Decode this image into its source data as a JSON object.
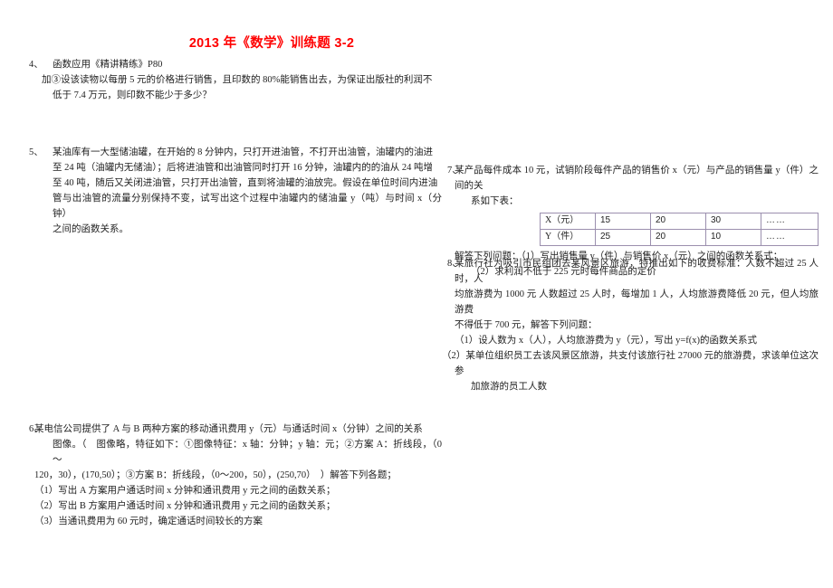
{
  "document": {
    "title": "2013 年《数学》训练题 3-2",
    "title_color": "#ff0000"
  },
  "problems": [
    {
      "id": "prob4",
      "number": "4、",
      "lines": [
        "函数应用《精讲精练》P80",
        "加③设该读物以每册 5 元的价格进行销售，且印数的 80%能销售出去，为保证出版社的利润不",
        "低于 7.4 万元，则印数不能少于多少？"
      ]
    },
    {
      "id": "prob5",
      "number": "5、",
      "lines": [
        "某油库有一大型储油罐，在开始的 8 分钟内，只打开进油管，不打开出油管，油罐内的油进",
        "至 24 吨（油罐内无储油）；后将进油管和出油管同时打开 16 分钟，油罐内的的油从 24 吨增",
        "至 40 吨，随后又关闭进油管，只打开出油管，直到将油罐的油放完。假设在单位时间内进油",
        "管与出油管的流量分别保持不变，试写出这个过程中油罐内的储油量 y（吨）与时间 x（分钟）",
        "之间的函数关系。"
      ]
    },
    {
      "id": "prob6",
      "number": "6、",
      "lines": [
        "某电信公司提供了 A 与 B 两种方案的移动通讯费用 y（元）与通话时间 x（分钟）之间的关系",
        "图像。（　图像略，特征如下：①图像特征：x 轴：分钟；y 轴：元；②方案 A：折线段，（0～",
        "120，30），(170,50）；③方案 B：折线段，（0～200，50），(250,70）　）解答下列各题；",
        "（1）写出 A 方案用户通话时间 x 分钟和通讯费用 y 元之间的函数关系；",
        "（2）写出 B 方案用户通话时间 x 分钟和通讯费用 y 元之间的函数关系；",
        "（3）当通讯费用为 60 元时，确定通话时间较长的方案"
      ]
    },
    {
      "id": "prob7",
      "number": "7、",
      "lines_before_table": [
        "某产品每件成本 10 元，试销阶段每件产品的销售价 x（元）与产品的销售量 y（件）之间的关",
        "系如下表："
      ],
      "lines_after_table": [
        "解答下列问题：（1）写出销售量 y（件）与销售价 x（元）之间的函数关系式；",
        "（2）求利润不低于 225 元时每件商品的定价"
      ],
      "table": {
        "rows": [
          {
            "header": "X（元）",
            "values": [
              "15",
              "20",
              "30",
              "……"
            ]
          },
          {
            "header": "Y（件）",
            "values": [
              "25",
              "20",
              "10",
              "……"
            ]
          }
        ]
      }
    },
    {
      "id": "prob8",
      "number": "8、",
      "lines": [
        "某旅行社为吸引市民组团去某风景区旅游，特推出如下的收费标准：人数不超过 25 人时，人",
        "均旅游费为 1000 元 人数超过 25 人时，每增加 1 人，人均旅游费降低 20 元，但人均旅游费",
        "不得低于 700 元，解答下列问题：",
        "（1）设人数为 x（人），人均旅游费为 y（元），写出 y=f(x)的函数关系式",
        "（2）某单位组织员工去该风景区旅游，共支付该旅行社 27000 元的旅游费，求该单位这次参",
        "加旅游的员工人数"
      ]
    }
  ]
}
